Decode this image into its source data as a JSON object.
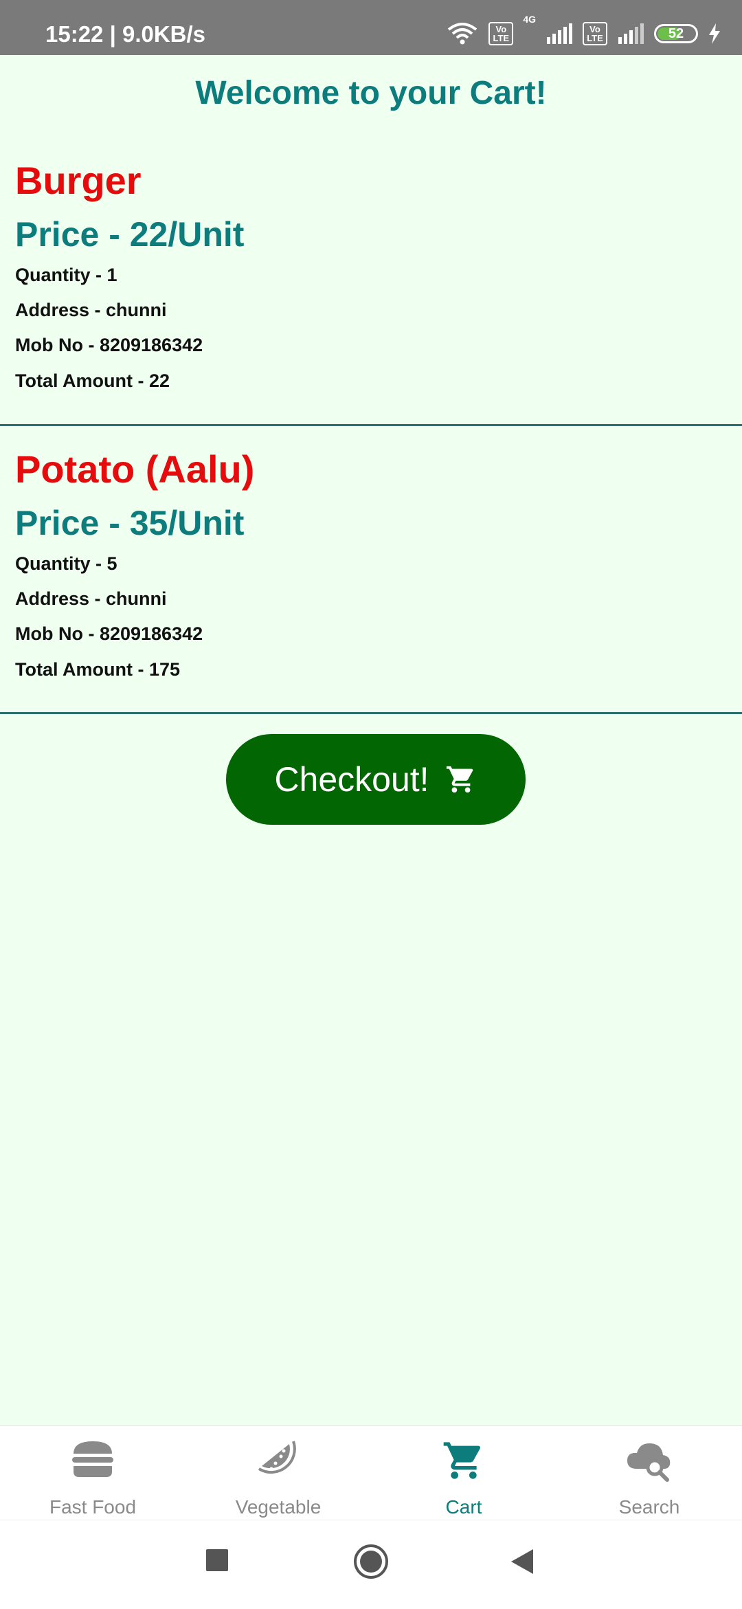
{
  "status_bar": {
    "time_speed": "15:22 | 9.0KB/s",
    "badge_volte_1": "Vo LTE",
    "network_type": "4G",
    "badge_volte_2": "Vo LTE",
    "battery": "52"
  },
  "header": {
    "title": "Welcome to your Cart!"
  },
  "cart_items": [
    {
      "name": "Burger",
      "price": "Price - 22/Unit",
      "quantity": "Quantity - 1",
      "address": "Address - chunni",
      "mobile": "Mob No - 8209186342",
      "total": "Total Amount - 22"
    },
    {
      "name": "Potato (Aalu)",
      "price": "Price - 35/Unit",
      "quantity": "Quantity - 5",
      "address": "Address - chunni",
      "mobile": "Mob No - 8209186342",
      "total": "Total Amount - 175"
    }
  ],
  "checkout": {
    "label": "Checkout!",
    "icon": "cart-icon"
  },
  "bottom_nav": {
    "items": [
      {
        "label": "Fast Food",
        "icon": "burger-icon",
        "active": false
      },
      {
        "label": "Vegetable",
        "icon": "watermelon-icon",
        "active": false
      },
      {
        "label": "Cart",
        "icon": "cart-icon",
        "active": true
      },
      {
        "label": "Search",
        "icon": "cloud-search-icon",
        "active": false
      }
    ]
  },
  "colors": {
    "background": "#effff0",
    "accent_teal": "#0c7c7c",
    "item_name_red": "#e40c0c",
    "checkout_green": "#026702",
    "inactive_gray": "#8a8a8a"
  }
}
